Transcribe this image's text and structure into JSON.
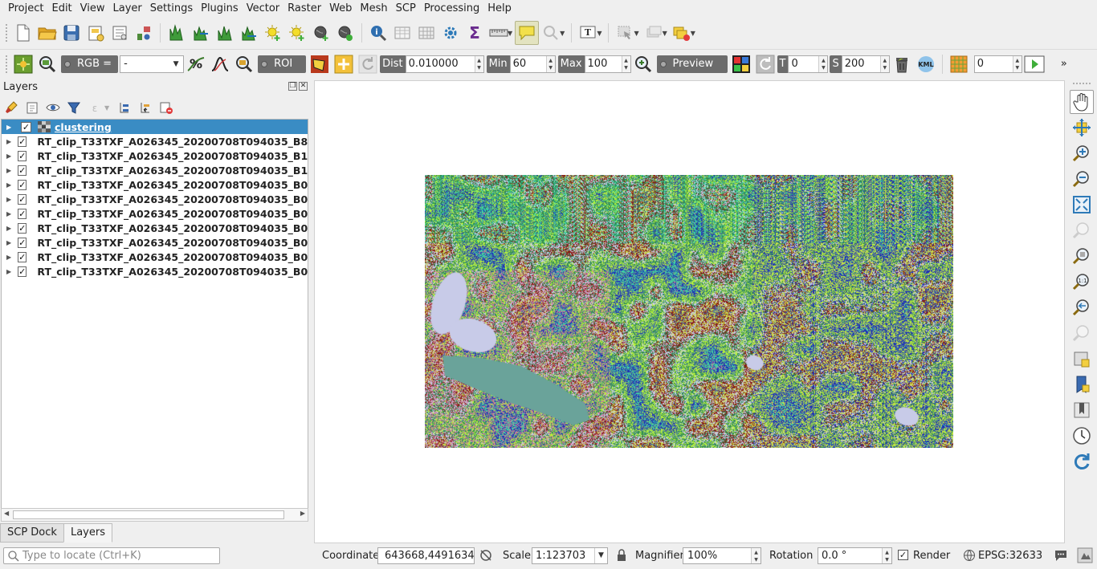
{
  "menu": [
    "Project",
    "Edit",
    "View",
    "Layer",
    "Settings",
    "Plugins",
    "Vector",
    "Raster",
    "Web",
    "Mesh",
    "SCP",
    "Processing",
    "Help"
  ],
  "scp_toolbar": {
    "rgb_label": "RGB =",
    "rgb_value": "-",
    "roi_label": "ROI",
    "dist_label": "Dist",
    "dist_value": "0.010000",
    "min_label": "Min",
    "min_value": "60",
    "max_label": "Max",
    "max_value": "100",
    "preview_label": "Preview",
    "t_label": "T",
    "t_value": "0",
    "s_label": "S",
    "s_value": "200",
    "kml_label": "KML",
    "band_value": "0"
  },
  "layers_panel": {
    "title": "Layers",
    "layers": [
      {
        "name": "clustering",
        "checked": true,
        "selected": true
      },
      {
        "name": "RT_clip_T33TXF_A026345_20200708T094035_B8",
        "checked": true,
        "selected": false
      },
      {
        "name": "RT_clip_T33TXF_A026345_20200708T094035_B1",
        "checked": true,
        "selected": false
      },
      {
        "name": "RT_clip_T33TXF_A026345_20200708T094035_B1",
        "checked": true,
        "selected": false
      },
      {
        "name": "RT_clip_T33TXF_A026345_20200708T094035_B0",
        "checked": true,
        "selected": false
      },
      {
        "name": "RT_clip_T33TXF_A026345_20200708T094035_B0",
        "checked": true,
        "selected": false
      },
      {
        "name": "RT_clip_T33TXF_A026345_20200708T094035_B0",
        "checked": true,
        "selected": false
      },
      {
        "name": "RT_clip_T33TXF_A026345_20200708T094035_B0",
        "checked": true,
        "selected": false
      },
      {
        "name": "RT_clip_T33TXF_A026345_20200708T094035_B0",
        "checked": true,
        "selected": false
      },
      {
        "name": "RT_clip_T33TXF_A026345_20200708T094035_B0",
        "checked": true,
        "selected": false
      },
      {
        "name": "RT_clip_T33TXF_A026345_20200708T094035_B0",
        "checked": true,
        "selected": false
      }
    ]
  },
  "panel_tabs": [
    "SCP Dock",
    "Layers"
  ],
  "active_tab": "Layers",
  "status": {
    "locate_placeholder": "Type to locate (Ctrl+K)",
    "coordinate_label": "Coordinate",
    "coordinate_value": "643668,4491634",
    "scale_label": "Scale",
    "scale_value": "1:123703",
    "magnifier_label": "Magnifier",
    "magnifier_value": "100%",
    "rotation_label": "Rotation",
    "rotation_value": "0.0 °",
    "render_label": "Render",
    "crs": "EPSG:32633"
  },
  "colors": {
    "selection": "#3a8cc4",
    "cluster_classes": [
      "#c9779a",
      "#3cd9a5",
      "#1e2fb8",
      "#5e9a8a",
      "#b6f23a",
      "#2e8a55",
      "#c8cbe8",
      "#8a1d14",
      "#cbd84a",
      "#4a5e9a",
      "#6aa39a"
    ]
  }
}
